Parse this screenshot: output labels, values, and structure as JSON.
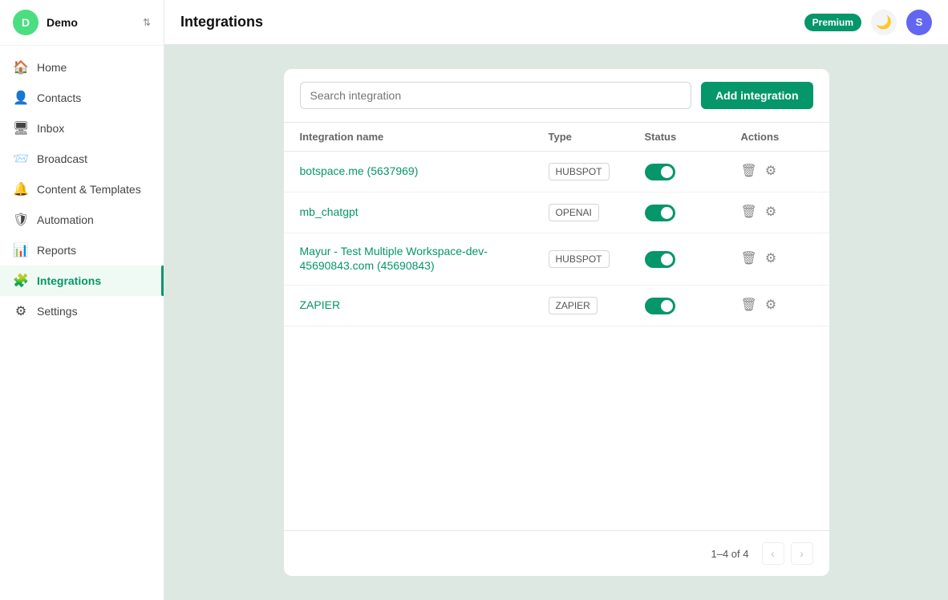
{
  "sidebar": {
    "workspace_initial": "D",
    "workspace_name": "Demo",
    "nav_items": [
      {
        "id": "home",
        "label": "Home",
        "icon": "🏠",
        "active": false
      },
      {
        "id": "contacts",
        "label": "Contacts",
        "icon": "👤",
        "active": false
      },
      {
        "id": "inbox",
        "label": "Inbox",
        "icon": "🖥",
        "active": false
      },
      {
        "id": "broadcast",
        "label": "Broadcast",
        "icon": "📨",
        "active": false
      },
      {
        "id": "content-templates",
        "label": "Content & Templates",
        "icon": "🔔",
        "active": false
      },
      {
        "id": "automation",
        "label": "Automation",
        "icon": "🛡",
        "active": false
      },
      {
        "id": "reports",
        "label": "Reports",
        "icon": "📊",
        "active": false
      },
      {
        "id": "integrations",
        "label": "Integrations",
        "icon": "🧩",
        "active": true
      },
      {
        "id": "settings",
        "label": "Settings",
        "icon": "⚙",
        "active": false
      }
    ]
  },
  "topbar": {
    "title": "Integrations",
    "premium_label": "Premium",
    "dark_toggle_icon": "🌙",
    "user_initial": "S"
  },
  "panel": {
    "search_placeholder": "Search integration",
    "add_button_label": "Add integration",
    "columns": [
      {
        "key": "name",
        "label": "Integration name"
      },
      {
        "key": "type",
        "label": "Type"
      },
      {
        "key": "status",
        "label": "Status"
      },
      {
        "key": "actions",
        "label": "Actions"
      }
    ],
    "integrations": [
      {
        "name": "botspace.me (5637969)",
        "type": "HUBSPOT",
        "enabled": true
      },
      {
        "name": "mb_chatgpt",
        "type": "OPENAI",
        "enabled": true
      },
      {
        "name": "Mayur - Test Multiple Workspace-dev-45690843.com (45690843)",
        "type": "HUBSPOT",
        "enabled": true
      },
      {
        "name": "ZAPIER",
        "type": "ZAPIER",
        "enabled": true
      }
    ],
    "pagination": {
      "text": "1–4 of 4",
      "of_label": "of 4"
    }
  },
  "colors": {
    "brand": "#059669",
    "accent": "#6366f1"
  }
}
